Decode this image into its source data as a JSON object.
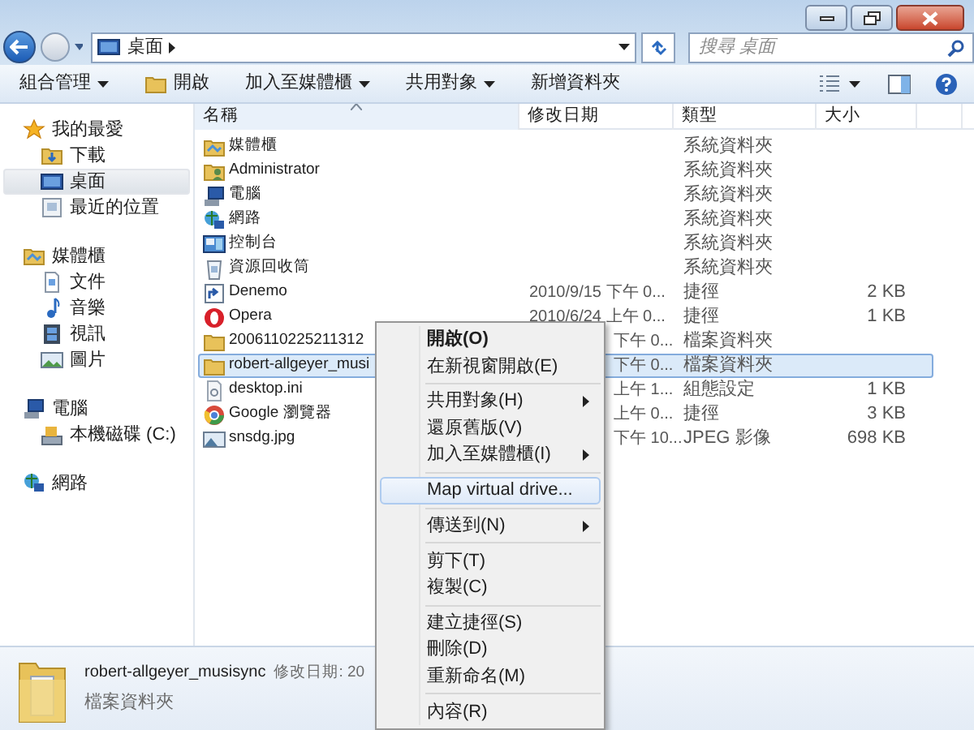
{
  "address": {
    "breadcrumb": [
      {
        "label": "桌面"
      }
    ],
    "search_placeholder": "搜尋 桌面"
  },
  "toolbar": {
    "buttons": [
      {
        "label": "組合管理",
        "dropdown": true
      },
      {
        "label": "開啟",
        "dropdown": false
      },
      {
        "label": "加入至媒體櫃",
        "dropdown": true
      },
      {
        "label": "共用對象",
        "dropdown": true
      },
      {
        "label": "新增資料夾",
        "dropdown": false
      }
    ]
  },
  "sidebar": {
    "groups": [
      {
        "label": "我的最愛",
        "children": [
          {
            "label": "下載",
            "selected": false
          },
          {
            "label": "桌面",
            "selected": true
          },
          {
            "label": "最近的位置",
            "selected": false
          }
        ]
      },
      {
        "label": "媒體櫃",
        "children": [
          {
            "label": "文件",
            "selected": false
          },
          {
            "label": "音樂",
            "selected": false
          },
          {
            "label": "視訊",
            "selected": false
          },
          {
            "label": "圖片",
            "selected": false
          }
        ]
      },
      {
        "label": "電腦",
        "children": [
          {
            "label": "本機磁碟 (C:)",
            "selected": false
          }
        ]
      },
      {
        "label": "網路"
      }
    ]
  },
  "file_list": {
    "columns": [
      {
        "label": "名稱",
        "sorted": true
      },
      {
        "label": "修改日期",
        "sorted": false
      },
      {
        "label": "類型",
        "sorted": false
      },
      {
        "label": "大小",
        "sorted": false
      }
    ],
    "rows": [
      {
        "name": "媒體櫃",
        "type": "系統資料夾",
        "selected": false
      },
      {
        "name": "Administrator",
        "type": "系統資料夾",
        "selected": false
      },
      {
        "name": "電腦",
        "type": "系統資料夾",
        "selected": false
      },
      {
        "name": "網路",
        "type": "系統資料夾",
        "selected": false
      },
      {
        "name": "控制台",
        "type": "系統資料夾",
        "selected": false
      },
      {
        "name": "資源回收筒",
        "type": "系統資料夾",
        "selected": false
      },
      {
        "name": "Denemo",
        "date": "2010/9/15 下午 0...",
        "date_covered": false,
        "type": "捷徑",
        "size": "2 KB",
        "selected": false
      },
      {
        "name": "Opera",
        "date": "2010/6/24 上午 0...",
        "date_covered": false,
        "type": "捷徑",
        "size": "1 KB",
        "selected": false
      },
      {
        "name": "2006110225211312",
        "date": "下午 0...",
        "date_covered": true,
        "type": "檔案資料夾",
        "selected": false
      },
      {
        "name": "robert-allgeyer_musi",
        "date": "下午 0...",
        "date_covered": true,
        "type": "檔案資料夾",
        "selected": true
      },
      {
        "name": "desktop.ini",
        "date": "上午 1...",
        "date_covered": true,
        "type": "組態設定",
        "size": "1 KB",
        "selected": false
      },
      {
        "name": "Google 瀏覽器",
        "date": "上午 0...",
        "date_covered": true,
        "type": "捷徑",
        "size": "3 KB",
        "selected": false
      },
      {
        "name": "snsdg.jpg",
        "date": "下午 10...",
        "date_covered": true,
        "type": "JPEG 影像",
        "size": "698 KB",
        "selected": false
      }
    ]
  },
  "context_menu": {
    "items": [
      {
        "kind": "item",
        "label": "開啟(O)",
        "default": true,
        "submenu": false,
        "selected": false
      },
      {
        "kind": "item",
        "label": "在新視窗開啟(E)",
        "default": false,
        "submenu": false,
        "selected": false
      },
      {
        "kind": "separator"
      },
      {
        "kind": "item",
        "label": "共用對象(H)",
        "default": false,
        "submenu": true,
        "selected": false
      },
      {
        "kind": "item",
        "label": "還原舊版(V)",
        "default": false,
        "submenu": false,
        "selected": false
      },
      {
        "kind": "item",
        "label": "加入至媒體櫃(I)",
        "default": false,
        "submenu": true,
        "selected": false
      },
      {
        "kind": "separator"
      },
      {
        "kind": "item",
        "label": "Map virtual drive...",
        "default": false,
        "submenu": false,
        "selected": true
      },
      {
        "kind": "separator"
      },
      {
        "kind": "item",
        "label": "傳送到(N)",
        "default": false,
        "submenu": true,
        "selected": false
      },
      {
        "kind": "separator"
      },
      {
        "kind": "item",
        "label": "剪下(T)",
        "default": false,
        "submenu": false,
        "selected": false
      },
      {
        "kind": "item",
        "label": "複製(C)",
        "default": false,
        "submenu": false,
        "selected": false
      },
      {
        "kind": "separator"
      },
      {
        "kind": "item",
        "label": "建立捷徑(S)",
        "default": false,
        "submenu": false,
        "selected": false
      },
      {
        "kind": "item",
        "label": "刪除(D)",
        "default": false,
        "submenu": false,
        "selected": false
      },
      {
        "kind": "item",
        "label": "重新命名(M)",
        "default": false,
        "submenu": false,
        "selected": false
      },
      {
        "kind": "separator"
      },
      {
        "kind": "item",
        "label": "內容(R)",
        "default": false,
        "submenu": false,
        "selected": false
      }
    ]
  },
  "details_pane": {
    "name": "robert-allgeyer_musisync",
    "meta": "修改日期: 20",
    "type": "檔案資料夾"
  }
}
